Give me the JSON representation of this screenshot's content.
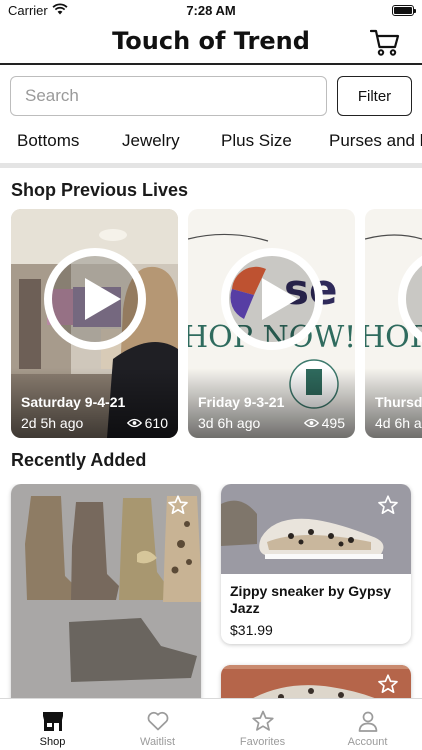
{
  "status_bar": {
    "carrier": "Carrier",
    "time": "7:28 AM"
  },
  "header": {
    "title": "Touch of Trend",
    "cart_icon": "cart-icon"
  },
  "search": {
    "placeholder": "Search",
    "value": "",
    "filter_label": "Filter"
  },
  "categories": [
    "Bottoms",
    "Jewelry",
    "Plus Size",
    "Purses and b"
  ],
  "previous_lives": {
    "title": "Shop Previous Lives",
    "items": [
      {
        "title": "Saturday 9-4-21",
        "ago": "2d 5h ago",
        "views": "610"
      },
      {
        "title": "Friday 9-3-21",
        "ago": "3d 6h ago",
        "views": "495"
      },
      {
        "title": "Thursda",
        "ago": "4d 6h a",
        "views": ""
      }
    ]
  },
  "recently_added": {
    "title": "Recently Added",
    "products": [
      {
        "name": "",
        "price": ""
      },
      {
        "name": "Zippy sneaker by Gypsy Jazz",
        "price": "$31.99"
      },
      {
        "name": "",
        "price": ""
      }
    ]
  },
  "tab_bar": {
    "tabs": [
      {
        "label": "Shop",
        "icon": "storefront-icon",
        "active": true
      },
      {
        "label": "Waitlist",
        "icon": "heart-icon",
        "active": false
      },
      {
        "label": "Favorites",
        "icon": "star-icon",
        "active": false
      },
      {
        "label": "Account",
        "icon": "person-icon",
        "active": false
      }
    ]
  },
  "colors": {
    "accent": "#111111",
    "tab_inactive": "#9b9b9b",
    "divider": "#e4e4e4"
  }
}
